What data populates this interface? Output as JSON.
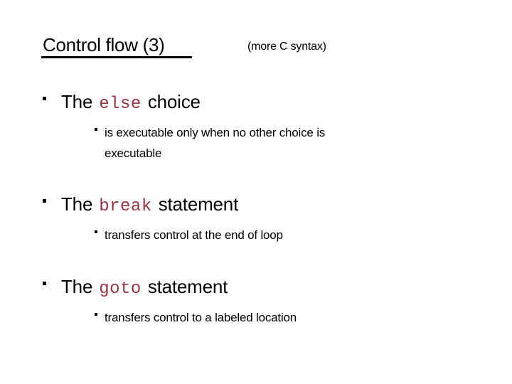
{
  "slide": {
    "title": "Control flow (3)",
    "subtitle": "(more C syntax)",
    "colors": {
      "background": "#ffffff",
      "text": "#000000",
      "keyword": "#993344"
    },
    "bullets": [
      {
        "prefix": "The",
        "keyword": "else",
        "suffix": "choice",
        "sub": [
          {
            "lines": [
              "is executable only when no other choice is",
              "executable"
            ]
          }
        ]
      },
      {
        "prefix": "The",
        "keyword": "break",
        "suffix": "statement",
        "sub": [
          {
            "lines": [
              "transfers control at the end of loop"
            ]
          }
        ]
      },
      {
        "prefix": "The",
        "keyword": "goto",
        "suffix": "statement",
        "sub": [
          {
            "lines": [
              "transfers control to a labeled location"
            ]
          }
        ]
      }
    ]
  }
}
